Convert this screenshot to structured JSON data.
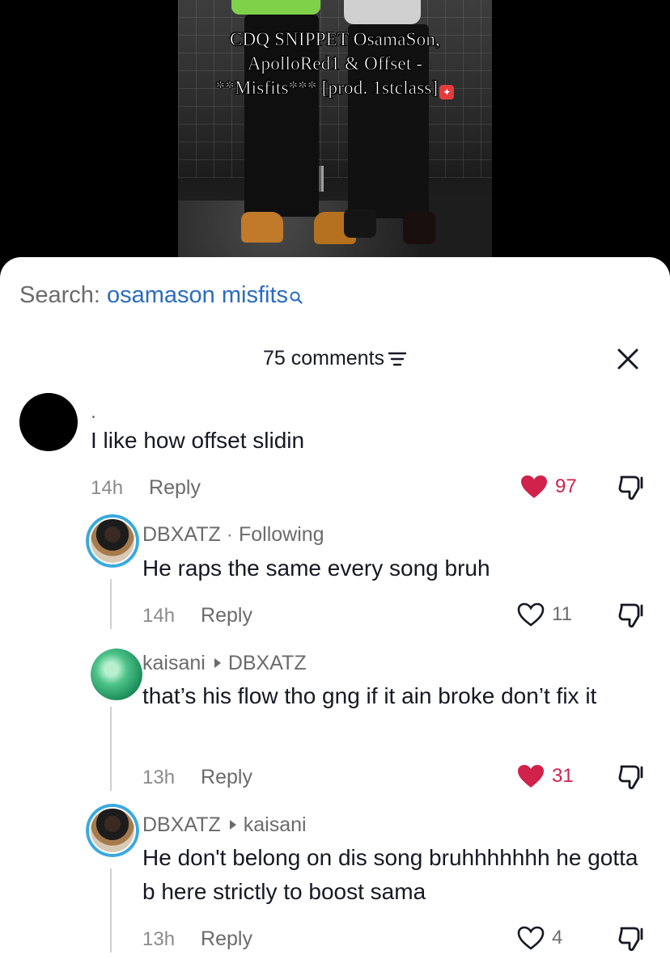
{
  "video": {
    "caption_line1": "CDQ SNIPPET OsamaSon,",
    "caption_line2": "ApolloRed1 & Offset -",
    "caption_line3": "**Misfits*** [prod. 1stclass]"
  },
  "search": {
    "label": "Search:",
    "query": "osamason misfits"
  },
  "header": {
    "comments_count": "75 comments"
  },
  "comments": [
    {
      "username": ".",
      "text": "I like how offset slidin",
      "time": "14h",
      "reply_label": "Reply",
      "likes": "97",
      "liked": true
    },
    {
      "username": "DBXATZ",
      "status": "Following",
      "text": "He raps the same every song bruh",
      "time": "14h",
      "reply_label": "Reply",
      "likes": "11",
      "liked": false
    },
    {
      "username": "kaisani",
      "reply_to": "DBXATZ",
      "text": "that’s his flow tho gng if it ain broke don’t fix it",
      "time": "13h",
      "reply_label": "Reply",
      "likes": "31",
      "liked": true
    },
    {
      "username": "DBXATZ",
      "reply_to": "kaisani",
      "text": "He don't belong on dis song bruhhhhhhh he gotta b here strictly to boost sama",
      "time": "13h",
      "reply_label": "Reply",
      "likes": "4",
      "liked": false
    }
  ],
  "colors": {
    "liked_heart": "#d0224a",
    "search_link": "#2a6bc0",
    "avatar_ring": "#3aa9de"
  }
}
